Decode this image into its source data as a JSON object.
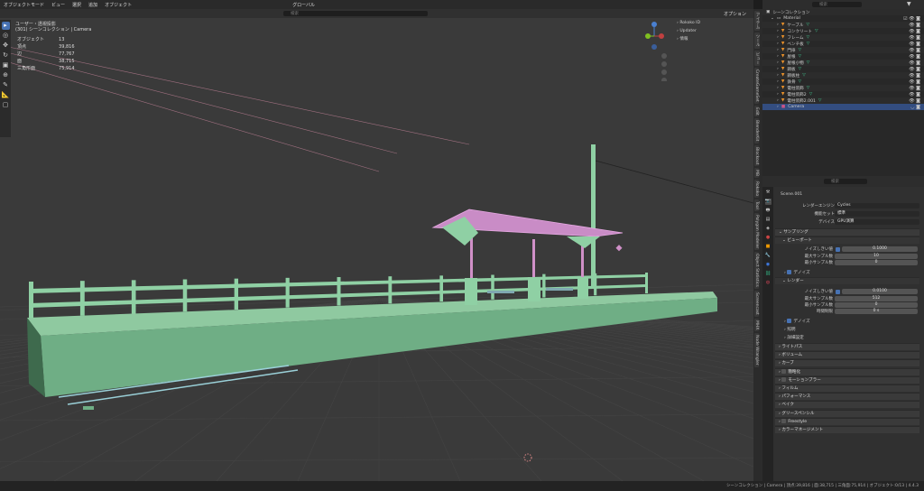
{
  "header": {
    "mode": "オブジェクトモード",
    "menus": [
      "ビュー",
      "選択",
      "追加",
      "オブジェクト"
    ],
    "transform_orientation": "グローバル",
    "options_label": "オプション",
    "search_placeholder": "検索"
  },
  "overlay": {
    "view_name": "ユーザー・透視投影",
    "collection_line": "(301) シーンコレクション | Camera",
    "stats": [
      {
        "label": "オブジェクト",
        "value": "13"
      },
      {
        "label": "頂点",
        "value": "39,816"
      },
      {
        "label": "辺",
        "value": "77,767"
      },
      {
        "label": "面",
        "value": "38,715"
      },
      {
        "label": "三角形面",
        "value": "75,914"
      }
    ]
  },
  "sidebar_panels": [
    "Rokoko ID",
    "Updater",
    "情報"
  ],
  "n_tabs": [
    "アイテム",
    "ツール",
    "ビュー",
    "CreateGameSet",
    "Edit",
    "BlenderKit",
    "Blockout",
    "MB",
    "Rokoko",
    "Tool",
    "Polygon Modeler",
    "Object Statistics",
    "Screencast",
    "MHX",
    "Node Wrangler"
  ],
  "outliner": {
    "search_placeholder": "検索",
    "root": "シーンコレクション",
    "collection": "Material",
    "items": [
      "ケーブル",
      "コンクリート",
      "フレーム",
      "ベンチ板",
      "門扉",
      "屋根",
      "屋根小物",
      "鋼板",
      "鋼板柱",
      "鉄骨",
      "電柱装飾",
      "電柱装飾2",
      "電柱装飾2.001"
    ],
    "selected": "Camera"
  },
  "properties": {
    "search_placeholder": "検索",
    "scene": "Scene.001",
    "render_engine_label": "レンダーエンジン",
    "render_engine": "Cycles",
    "feature_set_label": "機能セット",
    "feature_set": "標準",
    "device_label": "デバイス",
    "device": "GPU演算",
    "sampling": "サンプリング",
    "viewport": "ビューポート",
    "noise_threshold_label": "ノイズしきい値",
    "vp_noise": "0.1000",
    "max_samples_label": "最大サンプル数",
    "vp_max": "10",
    "min_samples_label": "最小サンプル数",
    "vp_min": "0",
    "denoise": "デノイズ",
    "render": "レンダー",
    "r_noise": "0.0100",
    "r_max": "512",
    "r_min": "0",
    "time_limit_label": "時間制限",
    "r_time": "0 s",
    "lights": "照明",
    "advanced": "詳細設定",
    "panels": [
      "ライトパス",
      "ボリューム",
      "カーブ",
      "簡略化",
      "モーションブラー",
      "フィルム",
      "パフォーマンス",
      "ベイク",
      "グリースペンシル",
      "Freestyle",
      "カラーマネージメント"
    ]
  },
  "status": {
    "text": "シーンコレクション | Camera | 頂点:39,816 | 面:38,715 | 三角面:75,914 | オブジェクト:0/13 | 4.4.3"
  }
}
